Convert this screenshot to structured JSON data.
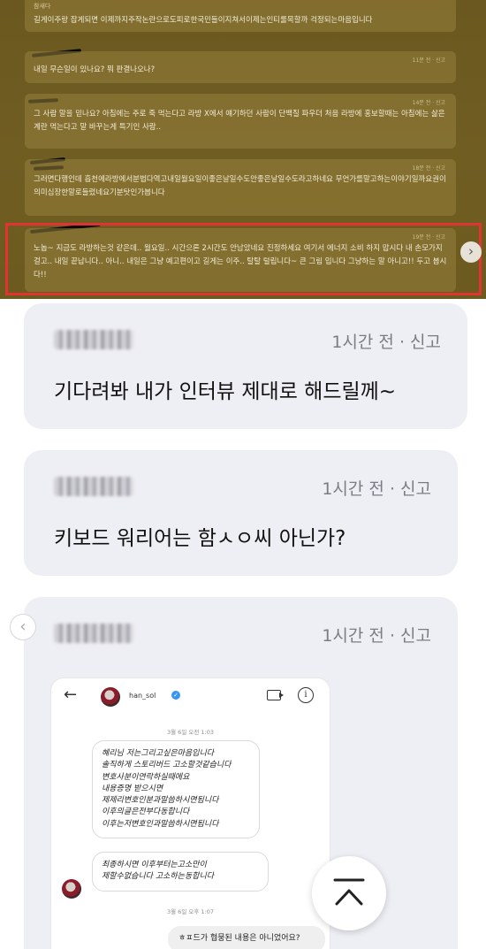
{
  "top_screenshot": {
    "first_line": "길게이주랑 잡게되면 이제까지주작논란으로도피로한국민들이지쳐서이제는인티룰목할까 걱정되는마음입니다",
    "first_author": "참새다",
    "cards": [
      {
        "meta": "11분 전 · 신고",
        "text": "내일 무슨일이 있나요? 뭐 판결나오나?"
      },
      {
        "meta": "14분 전 · 신고",
        "text": "그 사람 말을 믿나요? 아침에는 주로 죽 먹는다고 라방 X에서 얘기하던 사람이 단백질 파우더 처음 라방에 홍보할때는 아침에는 삶은 계란 먹는다고 말 바꾸는게 특기인 사람.."
      },
      {
        "meta": "18분 전 · 신고",
        "text": "그러면다행인데 흡천에라방에서분법다역고내일월요일이좋은날일수도안좋은날일수도라고하네요 무언가를말고하는이야기일까요권이의미심장한말로들렸네요기분탓인가봅니다"
      },
      {
        "meta": "19분 전 · 신고",
        "text": "노놉~ 지금도 라방하는것 같은데.. 월요일.. 시간으론 2시간도 안남았네요 진정하세요 여기서 에너지 소비 하지 맙시다 내 손모가지 걸고.. 내일 끝납니다.. 아니.. 내일은 그냥 예고편이고 길게는 이주.. 탈탈 털립니다~ 큰 그림 입니다 그냥하는 말 아니고!! 두고 봅시다!!"
      }
    ],
    "next_icon": "chevron-right-icon"
  },
  "comments": [
    {
      "meta": "1시간 전 · 신고",
      "text": "기다려봐 내가 인터뷰 제대로 해드릴께~"
    },
    {
      "meta": "1시간 전 · 신고",
      "text": "키보드 워리어는 함ㅅㅇ씨 아닌가?"
    },
    {
      "meta": "1시간 전 · 신고",
      "text": ""
    }
  ],
  "dm": {
    "username": "han_sol",
    "verified_icon": "verified-badge-icon",
    "date_top": "3월 6일 오전 1:03",
    "bubble_lines": [
      "혜리님 저는그리고싶은마음입니다",
      "솔직하게 스토리버드 고소할것같습니다",
      "변호사분이연락하실때에요",
      "내용증명 받으시면",
      "제제리변호인분과말씀하시면됩니다",
      "이후의글은전부다동합니다",
      "이후는저변호인과말씀하시면됩니다"
    ],
    "bubble2_lines": [
      "최종하시면 이후부터는고소만이",
      "제할수없습니다 고소하는동합니다"
    ],
    "date_bottom": "3월 6일 오후 1:07",
    "outgoing": "ㅎㅍ드가 협뭉된 내용은 아니었어요?"
  },
  "controls": {
    "prev_icon": "chevron-left-icon",
    "scroll_top_icon": "scroll-to-top-icon"
  },
  "colors": {
    "top_bg": "#6b5a1f",
    "highlight": "#e03434",
    "card_bg": "#eeeff4",
    "meta_text": "#7c7c84"
  }
}
